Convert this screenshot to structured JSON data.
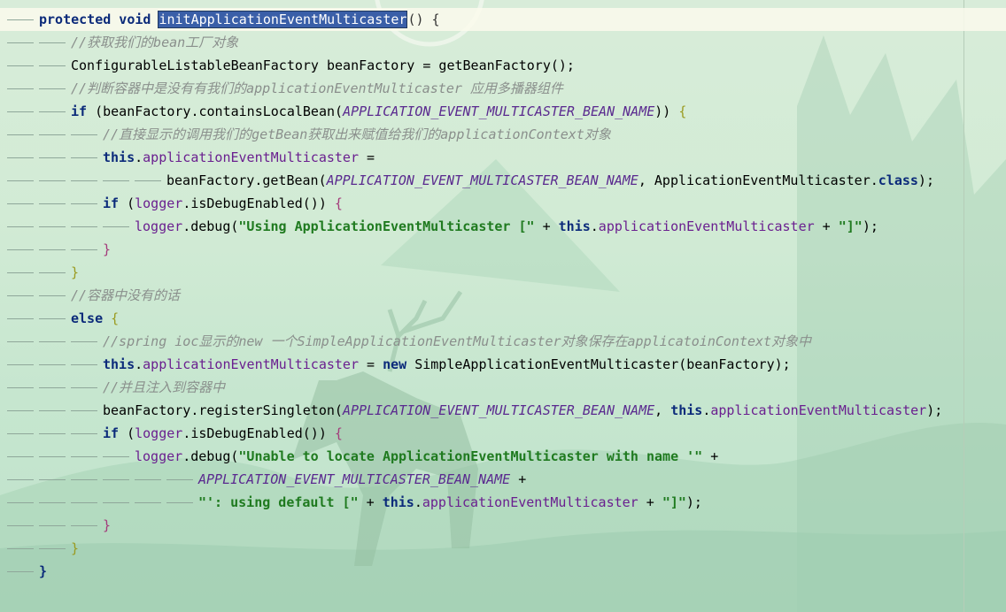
{
  "editor": {
    "code_lines": [
      {
        "indent": 0,
        "current": true,
        "tokens": [
          {
            "t": "protected void ",
            "c": "kw"
          },
          {
            "t": "initApplicationEventMulticaster",
            "c": "sel"
          },
          {
            "t": "",
            "c": "caret"
          },
          {
            "t": "() {",
            "c": "bkt"
          }
        ]
      },
      {
        "indent": 1,
        "tokens": [
          {
            "t": "//获取我们的bean工厂对象",
            "c": "cm"
          }
        ]
      },
      {
        "indent": 1,
        "tokens": [
          {
            "t": "ConfigurableListableBeanFactory beanFactory = getBeanFactory();",
            "c": ""
          }
        ]
      },
      {
        "indent": 1,
        "tokens": [
          {
            "t": "//判断容器中是没有有我们的applicationEventMulticaster 应用多播器组件",
            "c": "cm"
          }
        ]
      },
      {
        "indent": 1,
        "tokens": [
          {
            "t": "if ",
            "c": "kw"
          },
          {
            "t": "(beanFactory.containsLocalBean(",
            "c": ""
          },
          {
            "t": "APPLICATION_EVENT_MULTICASTER_BEAN_NAME",
            "c": "cst"
          },
          {
            "t": ")) ",
            "c": ""
          },
          {
            "t": "{",
            "c": "bkt2"
          }
        ]
      },
      {
        "indent": 2,
        "tokens": [
          {
            "t": "//直接显示的调用我们的getBean获取出来赋值给我们的applicationContext对象",
            "c": "cm"
          }
        ]
      },
      {
        "indent": 2,
        "tokens": [
          {
            "t": "this",
            "c": "kw"
          },
          {
            "t": ".",
            "c": ""
          },
          {
            "t": "applicationEventMulticaster",
            "c": "fld"
          },
          {
            "t": " =",
            "c": ""
          }
        ]
      },
      {
        "indent": 4,
        "tokens": [
          {
            "t": "beanFactory.getBean(",
            "c": ""
          },
          {
            "t": "APPLICATION_EVENT_MULTICASTER_BEAN_NAME",
            "c": "cst"
          },
          {
            "t": ", ApplicationEventMulticaster.",
            "c": ""
          },
          {
            "t": "class",
            "c": "kw"
          },
          {
            "t": ");",
            "c": ""
          }
        ]
      },
      {
        "indent": 2,
        "tokens": [
          {
            "t": "if ",
            "c": "kw"
          },
          {
            "t": "(",
            "c": ""
          },
          {
            "t": "logger",
            "c": "fld"
          },
          {
            "t": ".isDebugEnabled()) ",
            "c": ""
          },
          {
            "t": "{",
            "c": "bkt3"
          }
        ]
      },
      {
        "indent": 3,
        "tokens": [
          {
            "t": "logger",
            "c": "fld"
          },
          {
            "t": ".debug(",
            "c": ""
          },
          {
            "t": "\"Using ApplicationEventMulticaster [\"",
            "c": "str"
          },
          {
            "t": " + ",
            "c": ""
          },
          {
            "t": "this",
            "c": "kw"
          },
          {
            "t": ".",
            "c": ""
          },
          {
            "t": "applicationEventMulticaster",
            "c": "fld"
          },
          {
            "t": " + ",
            "c": ""
          },
          {
            "t": "\"]\"",
            "c": "str"
          },
          {
            "t": ");",
            "c": ""
          }
        ]
      },
      {
        "indent": 2,
        "tokens": [
          {
            "t": "}",
            "c": "bkt3"
          }
        ]
      },
      {
        "indent": 1,
        "tokens": [
          {
            "t": "}",
            "c": "bkt2"
          }
        ]
      },
      {
        "indent": 1,
        "tokens": [
          {
            "t": "//容器中没有的话",
            "c": "cm"
          }
        ]
      },
      {
        "indent": 1,
        "tokens": [
          {
            "t": "else ",
            "c": "kw"
          },
          {
            "t": "{",
            "c": "bkt2"
          }
        ]
      },
      {
        "indent": 2,
        "tokens": [
          {
            "t": "//spring ioc显示的new 一个SimpleApplicationEventMulticaster对象保存在applicatoinContext对象中",
            "c": "cm"
          }
        ]
      },
      {
        "indent": 2,
        "tokens": [
          {
            "t": "this",
            "c": "kw"
          },
          {
            "t": ".",
            "c": ""
          },
          {
            "t": "applicationEventMulticaster",
            "c": "fld"
          },
          {
            "t": " = ",
            "c": ""
          },
          {
            "t": "new ",
            "c": "kw"
          },
          {
            "t": "SimpleApplicationEventMulticaster(beanFactory);",
            "c": ""
          }
        ]
      },
      {
        "indent": 2,
        "tokens": [
          {
            "t": "//并且注入到容器中",
            "c": "cm"
          }
        ]
      },
      {
        "indent": 2,
        "tokens": [
          {
            "t": "beanFactory.registerSingleton(",
            "c": ""
          },
          {
            "t": "APPLICATION_EVENT_MULTICASTER_BEAN_NAME",
            "c": "cst"
          },
          {
            "t": ", ",
            "c": ""
          },
          {
            "t": "this",
            "c": "kw"
          },
          {
            "t": ".",
            "c": ""
          },
          {
            "t": "applicationEventMulticaster",
            "c": "fld"
          },
          {
            "t": ");",
            "c": ""
          }
        ]
      },
      {
        "indent": 2,
        "tokens": [
          {
            "t": "if ",
            "c": "kw"
          },
          {
            "t": "(",
            "c": ""
          },
          {
            "t": "logger",
            "c": "fld"
          },
          {
            "t": ".isDebugEnabled()) ",
            "c": ""
          },
          {
            "t": "{",
            "c": "bkt3"
          }
        ]
      },
      {
        "indent": 3,
        "tokens": [
          {
            "t": "logger",
            "c": "fld"
          },
          {
            "t": ".debug(",
            "c": ""
          },
          {
            "t": "\"Unable to locate ApplicationEventMulticaster with name '\"",
            "c": "str"
          },
          {
            "t": " +",
            "c": ""
          }
        ]
      },
      {
        "indent": 5,
        "tokens": [
          {
            "t": "APPLICATION_EVENT_MULTICASTER_BEAN_NAME",
            "c": "cst"
          },
          {
            "t": " +",
            "c": ""
          }
        ]
      },
      {
        "indent": 5,
        "tokens": [
          {
            "t": "\"': using default [\"",
            "c": "str"
          },
          {
            "t": " + ",
            "c": ""
          },
          {
            "t": "this",
            "c": "kw"
          },
          {
            "t": ".",
            "c": ""
          },
          {
            "t": "applicationEventMulticaster",
            "c": "fld"
          },
          {
            "t": " + ",
            "c": ""
          },
          {
            "t": "\"]\"",
            "c": "str"
          },
          {
            "t": ");",
            "c": ""
          }
        ]
      },
      {
        "indent": 2,
        "tokens": [
          {
            "t": "}",
            "c": "bkt3"
          }
        ]
      },
      {
        "indent": 1,
        "tokens": [
          {
            "t": "}",
            "c": "bkt2"
          }
        ]
      },
      {
        "indent": 0,
        "tokens": [
          {
            "t": "}",
            "c": "kw"
          }
        ]
      }
    ]
  }
}
